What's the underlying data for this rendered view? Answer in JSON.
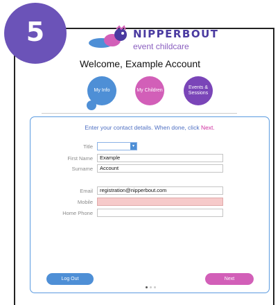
{
  "step_badge": {
    "number": "5"
  },
  "brand": {
    "name": "NIPPERBOUT",
    "tagline": "event childcare",
    "logo_icon": "bird-logo-icon",
    "colors": {
      "primary": "#4a3aa0",
      "accent": "#d25fb8",
      "blue": "#4e8fd6"
    }
  },
  "welcome": "Welcome, Example Account",
  "nav": {
    "my_info": "My Info",
    "my_children": "My Children",
    "events_sessions": "Events & Sessions",
    "active": "my_info"
  },
  "form": {
    "instruction_prefix": "Enter your contact details.  When done, click ",
    "instruction_next": "Next.",
    "title": {
      "label": "Title",
      "value": ""
    },
    "first_name": {
      "label": "First Name",
      "value": "Example"
    },
    "surname": {
      "label": "Surname",
      "value": "Account"
    },
    "email": {
      "label": "Email",
      "value": "registration@nipperbout.com"
    },
    "mobile": {
      "label": "Mobile",
      "value": "",
      "invalid": true
    },
    "home_phone": {
      "label": "Home Phone",
      "value": ""
    }
  },
  "buttons": {
    "logout": "Log Out",
    "next": "Next"
  },
  "page_indicator": {
    "count": 3,
    "current": 1
  }
}
